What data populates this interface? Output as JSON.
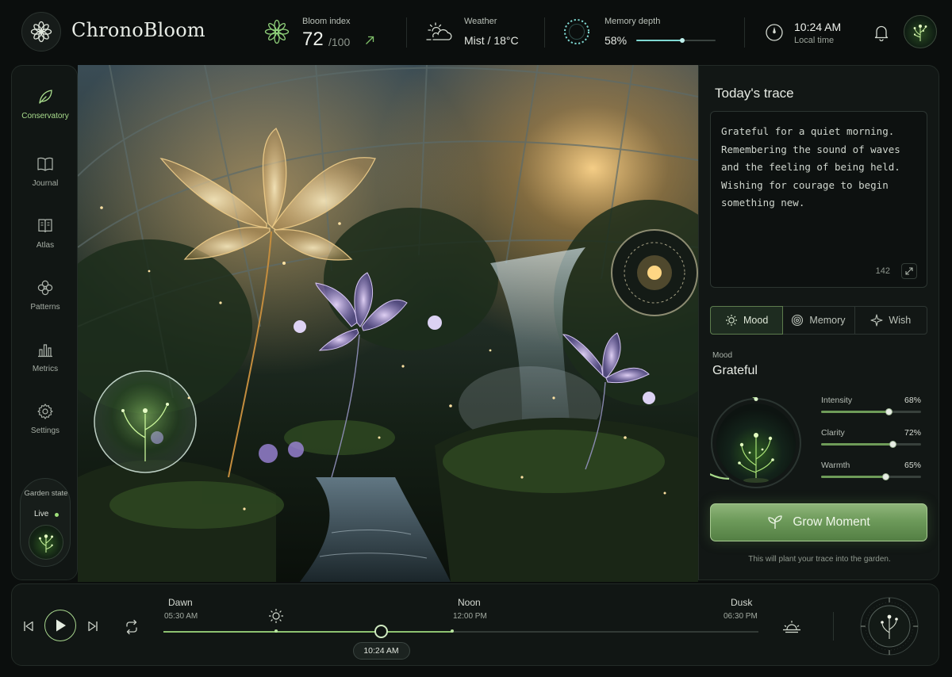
{
  "app": {
    "title": "ChronoBloom"
  },
  "header": {
    "bloom": {
      "label": "Bloom index",
      "value": "72",
      "max": "/100"
    },
    "weather": {
      "label": "Weather",
      "value": "Mist / 18°C"
    },
    "memory": {
      "label": "Memory depth",
      "value": "58%",
      "level": 0.58
    },
    "clock": {
      "time": "10:24 AM",
      "label": "Local time"
    }
  },
  "sidebar": {
    "items": [
      {
        "label": "Conservatory",
        "icon": "leaf-icon",
        "active": true
      },
      {
        "label": "Journal",
        "icon": "book-icon"
      },
      {
        "label": "Atlas",
        "icon": "atlas-icon"
      },
      {
        "label": "Patterns",
        "icon": "flower-pattern-icon"
      },
      {
        "label": "Metrics",
        "icon": "bar-chart-icon"
      },
      {
        "label": "Settings",
        "icon": "gear-icon"
      }
    ],
    "garden_state": {
      "label": "Garden state",
      "status": "Live"
    }
  },
  "panel": {
    "title": "Today's trace",
    "trace_text": "Grateful for a quiet morning.\nRemembering the sound of waves\nand the feeling of being held.\nWishing for courage to begin\nsomething new.",
    "char_count": "142",
    "tabs": [
      {
        "label": "Mood",
        "icon": "sun-icon",
        "active": true
      },
      {
        "label": "Memory",
        "icon": "spiral-icon"
      },
      {
        "label": "Wish",
        "icon": "sparkle-icon"
      }
    ],
    "mood": {
      "kicker": "Mood",
      "value": "Grateful",
      "sliders": [
        {
          "label": "Intensity",
          "display": "68%",
          "value": 0.68
        },
        {
          "label": "Clarity",
          "display": "72%",
          "value": 0.72
        },
        {
          "label": "Warmth",
          "display": "65%",
          "value": 0.65
        }
      ]
    },
    "grow_button": "Grow Moment",
    "grow_hint": "This will plant your trace into the garden."
  },
  "timeline": {
    "marks": [
      {
        "name": "Dawn",
        "time": "05:30 AM"
      },
      {
        "name": "Noon",
        "time": "12:00 PM"
      },
      {
        "name": "Dusk",
        "time": "06:30 PM"
      }
    ],
    "now": "10:24 AM",
    "progress": 0.366
  },
  "colors": {
    "accent": "#8dc170",
    "accent_soft": "#a9dd8d",
    "background": "#0b0e0d",
    "panel": "#121715",
    "memory_accent": "#7fd8d2"
  }
}
